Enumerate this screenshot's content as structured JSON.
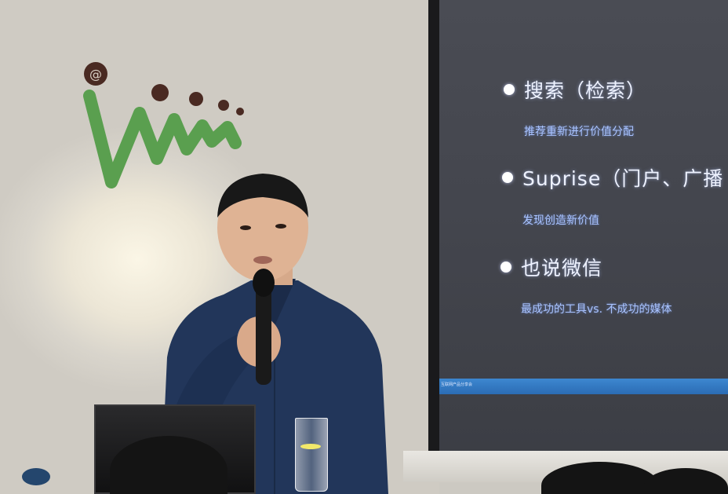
{
  "slide": {
    "bullets": [
      {
        "title": "搜索（检索）",
        "sub": "推荐重新进行价值分配"
      },
      {
        "title": "Suprise（门户、广播",
        "sub": "发现创造新价值"
      },
      {
        "title": "也说微信",
        "sub": "最成功的工具vs. 不成功的媒体"
      }
    ],
    "footer": "互联网产品分享会"
  },
  "logo": {
    "mark": "@",
    "letter_color": "#5a9f4f",
    "dot_color": "#4a2a22"
  },
  "colors": {
    "slide_bg": "#45474f",
    "slide_text": "#eef2ff",
    "slide_sub": "#a9c3ff",
    "footer_bar": "#3279c2",
    "shirt": "#22365a"
  }
}
